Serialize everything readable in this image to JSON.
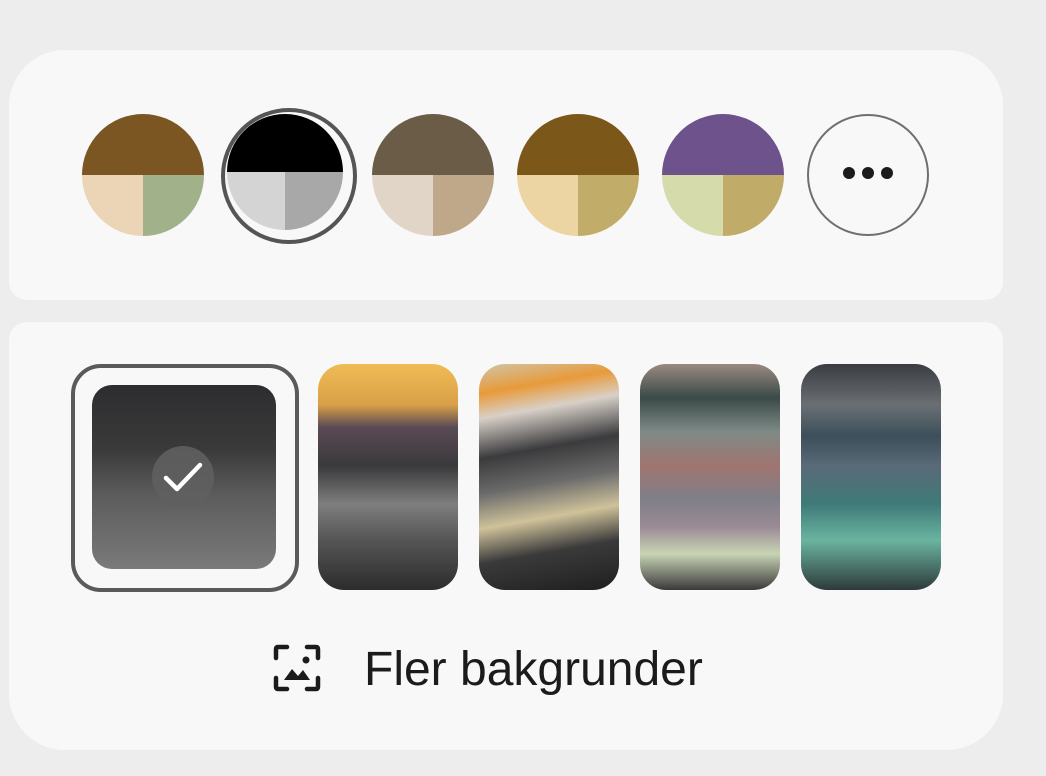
{
  "color_swatches": [
    {
      "id": "swatch-1",
      "top": "#7b5623",
      "bottom_left": "#ebd5b6",
      "bottom_right": "#a1b18a",
      "selected": false
    },
    {
      "id": "swatch-2",
      "top": "#000000",
      "bottom_left": "#d4d4d4",
      "bottom_right": "#a8a8a8",
      "selected": true
    },
    {
      "id": "swatch-3",
      "top": "#6b5c48",
      "bottom_left": "#e1d5c8",
      "bottom_right": "#bfa78a",
      "selected": false
    },
    {
      "id": "swatch-4",
      "top": "#7b5719",
      "bottom_left": "#edd5a3",
      "bottom_right": "#c1ac69",
      "selected": false
    },
    {
      "id": "swatch-5",
      "top": "#6e528c",
      "bottom_left": "#d5dbaa",
      "bottom_right": "#c1ab69",
      "selected": false
    }
  ],
  "more_colors_icon": "more-horizontal-icon",
  "wallpapers": {
    "selected_index": 0,
    "selected_icon": "check-icon",
    "count": 5
  },
  "more_wallpapers": {
    "label": "Fler bakgrunder",
    "icon": "image-frame-icon"
  }
}
